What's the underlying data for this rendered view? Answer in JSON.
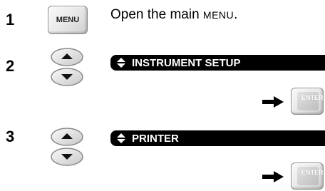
{
  "steps": [
    {
      "number": "1",
      "key_label": "MENU",
      "text_prefix": "Open the main ",
      "text_key": "MENU",
      "text_suffix": "."
    },
    {
      "number": "2",
      "menu_item": "INSTRUMENT SETUP",
      "confirm_key": "ENTER"
    },
    {
      "number": "3",
      "menu_item": "PRINTER",
      "confirm_key": "ENTER"
    }
  ],
  "icons": {
    "updown": "up-down-arrow-keys",
    "selector": "up-down-selector-icon",
    "arrow": "right-arrow-icon"
  }
}
